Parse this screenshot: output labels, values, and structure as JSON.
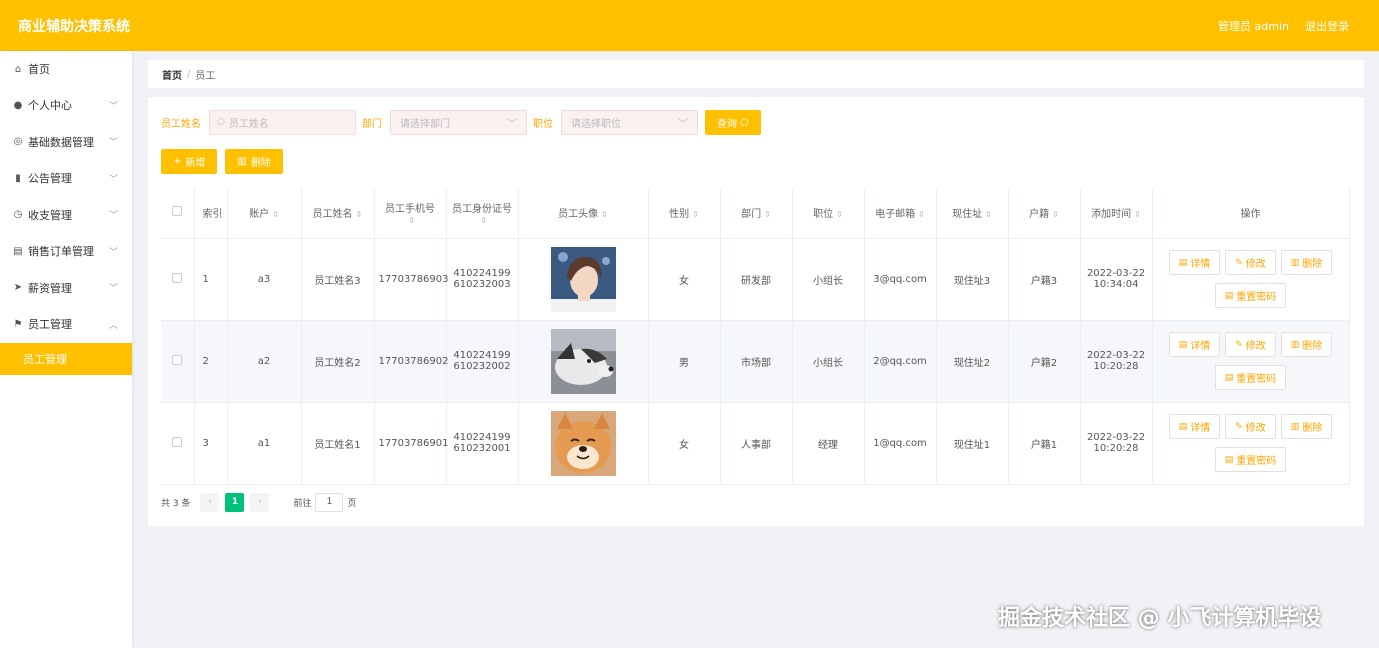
{
  "app": {
    "title": "商业辅助决策系统",
    "user": "管理员 admin",
    "logout": "退出登录"
  },
  "sidebar": {
    "items": [
      {
        "label": "首页",
        "icon": "home-icon",
        "expandable": false
      },
      {
        "label": "个人中心",
        "icon": "user-icon",
        "expandable": true
      },
      {
        "label": "基础数据管理",
        "icon": "settings-icon",
        "expandable": true
      },
      {
        "label": "公告管理",
        "icon": "chart-icon",
        "expandable": true
      },
      {
        "label": "收支管理",
        "icon": "clock-icon",
        "expandable": true
      },
      {
        "label": "销售订单管理",
        "icon": "document-icon",
        "expandable": true
      },
      {
        "label": "薪资管理",
        "icon": "send-icon",
        "expandable": true
      },
      {
        "label": "员工管理",
        "icon": "flag-icon",
        "expandable": true,
        "expanded": true
      }
    ],
    "active_sub": "员工管理"
  },
  "breadcrumb": {
    "home": "首页",
    "sep": "/",
    "current": "员工"
  },
  "search": {
    "name_label": "员工姓名",
    "name_placeholder": "员工姓名",
    "dept_label": "部门",
    "dept_placeholder": "请选择部门",
    "pos_label": "职位",
    "pos_placeholder": "请选择职位",
    "query_btn": "查询"
  },
  "actions": {
    "add": "新增",
    "delete": "删除"
  },
  "table": {
    "headers": {
      "index": "索引",
      "account": "账户",
      "name": "员工姓名",
      "phone": "员工手机号",
      "idcard": "员工身份证号",
      "avatar": "员工头像",
      "gender": "性别",
      "dept": "部门",
      "position": "职位",
      "email": "电子邮箱",
      "address": "现住址",
      "hukou": "户籍",
      "added": "添加时间",
      "ops": "操作"
    },
    "rows": [
      {
        "index": "1",
        "account": "a3",
        "name": "员工姓名3",
        "phone": "17703786903",
        "idcard": "410224199610232003",
        "avatar": "person",
        "gender": "女",
        "dept": "研发部",
        "position": "小组长",
        "email": "3@qq.com",
        "address": "现住址3",
        "hukou": "户籍3",
        "added": "2022-03-22 10:34:04"
      },
      {
        "index": "2",
        "account": "a2",
        "name": "员工姓名2",
        "phone": "17703786902",
        "idcard": "410224199610232002",
        "avatar": "husky",
        "gender": "男",
        "dept": "市场部",
        "position": "小组长",
        "email": "2@qq.com",
        "address": "现住址2",
        "hukou": "户籍2",
        "added": "2022-03-22 10:20:28"
      },
      {
        "index": "3",
        "account": "a1",
        "name": "员工姓名1",
        "phone": "17703786901",
        "idcard": "410224199610232001",
        "avatar": "shiba",
        "gender": "女",
        "dept": "人事部",
        "position": "经理",
        "email": "1@qq.com",
        "address": "现住址1",
        "hukou": "户籍1",
        "added": "2022-03-22 10:20:28"
      }
    ],
    "op_labels": {
      "detail": "详情",
      "edit": "修改",
      "delete": "删除",
      "reset": "重置密码"
    }
  },
  "pagination": {
    "total": "共 3 条",
    "current": "1",
    "goto": "前往",
    "goto_value": "1",
    "page_suffix": "页"
  },
  "watermark": "掘金技术社区 @ 小飞计算机毕设",
  "colors": {
    "accent": "#ffc000",
    "active_page": "#00c17c"
  }
}
